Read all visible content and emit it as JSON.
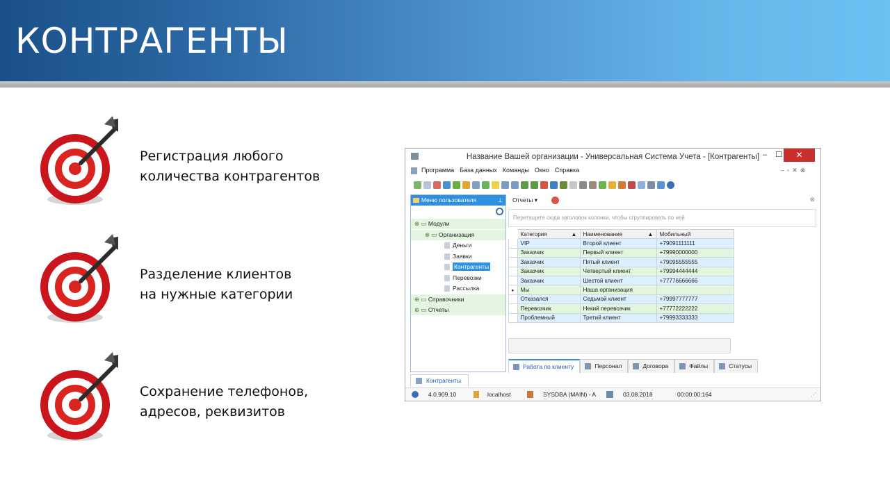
{
  "slide": {
    "title": "КОНТРАГЕНТЫ",
    "features": [
      {
        "line1": "Регистрация любого",
        "line2": "количества контрагентов"
      },
      {
        "line1": "Разделение клиентов",
        "line2": "на нужные категории"
      },
      {
        "line1": "Сохранение телефонов,",
        "line2": "адресов, реквизитов"
      }
    ]
  },
  "window": {
    "title": "Название Вашей организации - Универсальная Система Учета - [Контрагенты]",
    "controls": {
      "minimize": "–",
      "maximize": "☐",
      "close": "✕"
    },
    "menu": [
      "Программа",
      "База данных",
      "Команды",
      "Окно",
      "Справка"
    ],
    "sidebar": {
      "header": "Меню пользователя",
      "tree": [
        {
          "label": "Модули",
          "level": 0
        },
        {
          "label": "Организация",
          "level": 1
        },
        {
          "label": "Деньги",
          "level": 2
        },
        {
          "label": "Заявки",
          "level": 2
        },
        {
          "label": "Контрагенты",
          "level": 2,
          "selected": true
        },
        {
          "label": "Перевозки",
          "level": 2
        },
        {
          "label": "Рассылка",
          "level": 2
        },
        {
          "label": "Справочники",
          "level": 0
        },
        {
          "label": "Отчеты",
          "level": 0
        }
      ]
    },
    "reports_button": "Отчеты",
    "group_panel_hint": "Перетащите сюда заголовок колонки, чтобы сгруппировать по ней",
    "grid": {
      "columns": [
        "Категория",
        "Наименование",
        "Мобильный"
      ],
      "rows": [
        [
          "VIP",
          "Второй клиент",
          "+79091111111"
        ],
        [
          "Заказчик",
          "Первый клиент",
          "+79990000000"
        ],
        [
          "Заказчик",
          "Пятый клиент",
          "+79095555555"
        ],
        [
          "Заказчик",
          "Четвертый клиент",
          "+79994444444"
        ],
        [
          "Заказчик",
          "Шестой клиент",
          "+77776666666"
        ],
        [
          "Мы",
          "Наша организация",
          ""
        ],
        [
          "Отказался",
          "Седьмой клиент",
          "+79997777777"
        ],
        [
          "Перевозчик",
          "Некий перевозчик",
          "+77772222222"
        ],
        [
          "Проблемный",
          "Третий клиент",
          "+79993333333"
        ]
      ]
    },
    "tabs": [
      "Работа по клиенту",
      "Персонал",
      "Договора",
      "Файлы",
      "Статусы"
    ],
    "bottom_tab": "Контрагенты",
    "status": {
      "version": "4.0.909.10",
      "host": "localhost",
      "user": "SYSDBA (MAIN) - A",
      "date": "03.08.2018",
      "timer": "00:00:00:164"
    },
    "accent": "#2f8fe0"
  }
}
